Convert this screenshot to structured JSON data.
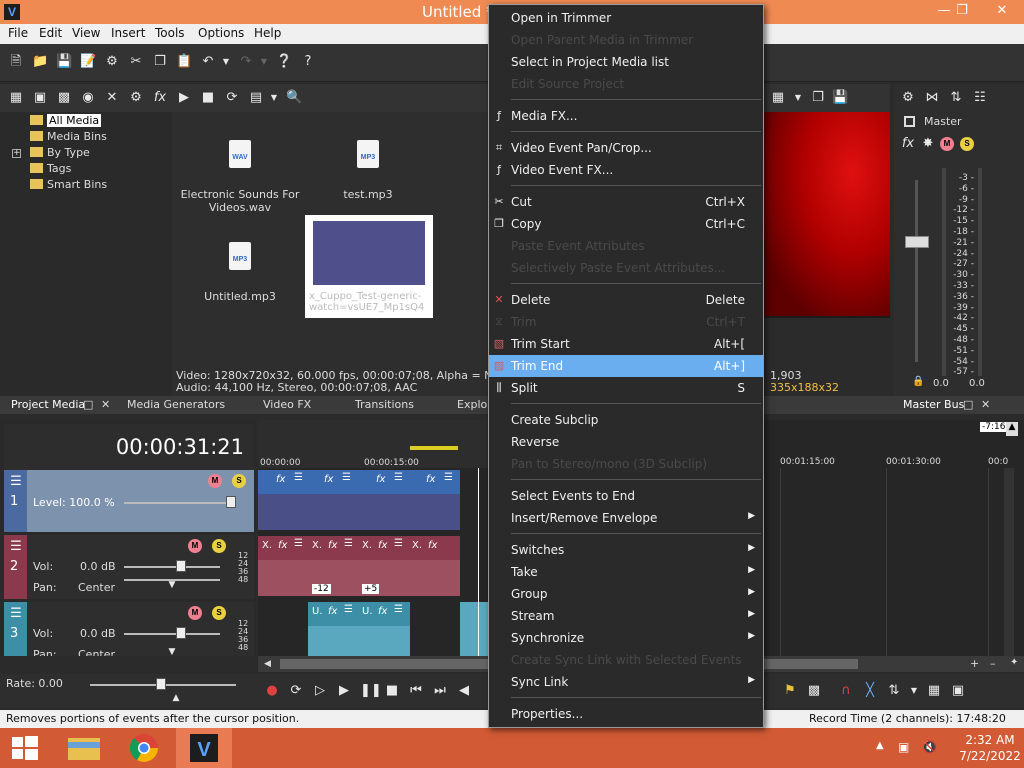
{
  "window": {
    "title": "Untitled *",
    "app_icon": "V"
  },
  "menubar": [
    "File",
    "Edit",
    "View",
    "Insert",
    "Tools",
    "Options",
    "Help"
  ],
  "explorer": {
    "tree": [
      "All Media",
      "Media Bins",
      "By Type",
      "Tags",
      "Smart Bins"
    ],
    "files": [
      {
        "ext": "WAV",
        "name": "Electronic Sounds For Videos.wav"
      },
      {
        "ext": "MP3",
        "name": "test.mp3"
      },
      {
        "ext": "MP3",
        "name": "Untitled.mp3"
      }
    ],
    "thumb_label": "x_Cuppo_Test-generic-watch=vsUE7_Mp1sQ4",
    "info_line1": "Video: 1280x720x32, 60.000 fps, 00:00:07;08, Alpha = None, F",
    "info_line2": "Audio: 44,100 Hz, Stereo, 00:00:07;08, AAC"
  },
  "preview": {
    "frame": "1,903",
    "dims": "335x188x32"
  },
  "master": {
    "label": "Master",
    "db_scale": [
      "3",
      "6",
      "9",
      "12",
      "15",
      "18",
      "21",
      "24",
      "27",
      "30",
      "33",
      "36",
      "39",
      "42",
      "45",
      "48",
      "51",
      "54",
      "57"
    ],
    "left_val": "0.0",
    "right_val": "0.0"
  },
  "tabs": {
    "project_media": "Project Media",
    "media_generators": "Media Generators",
    "video_fx": "Video FX",
    "transitions": "Transitions",
    "explorer": "Explor",
    "master_bus": "Master Bus"
  },
  "timeline": {
    "timecode": "00:00:31:21",
    "ruler": [
      "00:00:00",
      "00:00:15:00"
    ],
    "ruler_right": [
      "00:01:15:00",
      "00:01:30:00",
      "00:0"
    ],
    "badge_left": "-7:16",
    "tracks": [
      {
        "num": "1",
        "level_label": "Level: 100.0 %"
      },
      {
        "num": "2",
        "vol_label": "Vol:",
        "vol_value": "0.0 dB",
        "pan_label": "Pan:",
        "pan_value": "Center"
      },
      {
        "num": "3",
        "vol_label": "Vol:",
        "vol_value": "0.0 dB",
        "pan_label": "Pan:",
        "pan_value": "Center"
      }
    ],
    "db_ticks": [
      "12",
      "24",
      "36",
      "48"
    ],
    "clip_badges": [
      "-12",
      "+5"
    ],
    "rate": "Rate: 0.00"
  },
  "context_menu": [
    {
      "label": "Open in Trimmer",
      "enabled": true
    },
    {
      "label": "Open Parent Media in Trimmer",
      "enabled": false
    },
    {
      "label": "Select in Project Media list",
      "enabled": true
    },
    {
      "label": "Edit Source Project",
      "enabled": false
    },
    {
      "sep": true
    },
    {
      "label": "Media FX...",
      "enabled": true,
      "icon": "fx"
    },
    {
      "sep": true
    },
    {
      "label": "Video Event Pan/Crop...",
      "enabled": true,
      "icon": "crop"
    },
    {
      "label": "Video Event FX...",
      "enabled": true,
      "icon": "fx"
    },
    {
      "sep": true
    },
    {
      "label": "Cut",
      "shortcut": "Ctrl+X",
      "enabled": true,
      "icon": "scissors"
    },
    {
      "label": "Copy",
      "shortcut": "Ctrl+C",
      "enabled": true,
      "icon": "copy"
    },
    {
      "label": "Paste Event Attributes",
      "enabled": false
    },
    {
      "label": "Selectively Paste Event Attributes...",
      "enabled": false
    },
    {
      "sep": true
    },
    {
      "label": "Delete",
      "shortcut": "Delete",
      "enabled": true,
      "icon": "x"
    },
    {
      "label": "Trim",
      "shortcut": "Ctrl+T",
      "enabled": false,
      "icon": "trim"
    },
    {
      "label": "Trim Start",
      "shortcut": "Alt+[",
      "enabled": true,
      "icon": "trim-start"
    },
    {
      "label": "Trim End",
      "shortcut": "Alt+]",
      "enabled": true,
      "icon": "trim-end",
      "highlighted": true
    },
    {
      "label": "Split",
      "shortcut": "S",
      "enabled": true,
      "icon": "split"
    },
    {
      "sep": true
    },
    {
      "label": "Create Subclip",
      "enabled": true
    },
    {
      "label": "Reverse",
      "enabled": true
    },
    {
      "label": "Pan to Stereo/mono (3D Subclip)",
      "enabled": false
    },
    {
      "sep": true
    },
    {
      "label": "Select Events to End",
      "enabled": true
    },
    {
      "label": "Insert/Remove Envelope",
      "enabled": true,
      "submenu": true
    },
    {
      "sep": true
    },
    {
      "label": "Switches",
      "enabled": true,
      "submenu": true
    },
    {
      "label": "Take",
      "enabled": true,
      "submenu": true
    },
    {
      "label": "Group",
      "enabled": true,
      "submenu": true
    },
    {
      "label": "Stream",
      "enabled": true,
      "submenu": true
    },
    {
      "label": "Synchronize",
      "enabled": true,
      "submenu": true
    },
    {
      "label": "Create Sync Link with Selected Events",
      "enabled": false
    },
    {
      "label": "Sync Link",
      "enabled": true,
      "submenu": true
    },
    {
      "sep": true
    },
    {
      "label": "Properties...",
      "enabled": true
    }
  ],
  "statusbar": {
    "message": "Removes portions of events after the cursor position.",
    "record_time": "Record Time (2 channels): 17:48:20"
  },
  "taskbar": {
    "time": "2:32 AM",
    "date": "7/22/2022"
  },
  "colors": {
    "titlebar": "#ef8a52",
    "taskbar": "#d25a34",
    "highlight": "#6aaef0",
    "video_track": "#4b6a9f",
    "audio_track2": "#8a3a4c",
    "audio_track3": "#3d8fa8"
  }
}
